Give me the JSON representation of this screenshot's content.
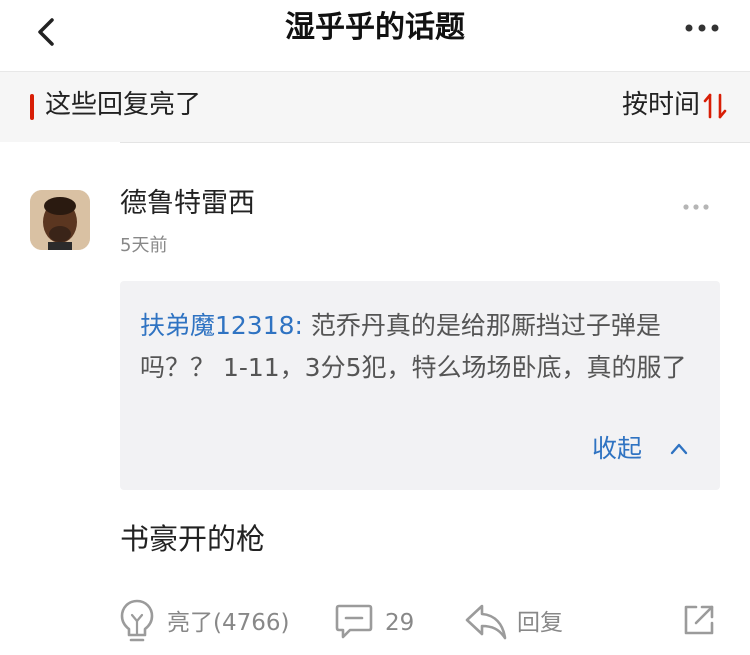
{
  "nav": {
    "title": "湿乎乎的话题",
    "back_icon": "chevron-left-icon",
    "more_icon": "more-horizontal-icon"
  },
  "section": {
    "title": "这些回复亮了",
    "sort_label": "按时间",
    "sort_icon": "sort-arrows-icon",
    "accent_color": "#d81e06"
  },
  "comment": {
    "username": "德鲁特雷西",
    "time": "5天前",
    "quote": {
      "author": "扶弟魔12318:",
      "text": " 范乔丹真的是给那厮挡过子弹是吗？？ 1-11，3分5犯，特么场场卧底，真的服了",
      "collapse_label": "收起"
    },
    "reply_text": "书豪开的枪",
    "actions": {
      "like_label": "亮了(4766)",
      "comment_count": "29",
      "reply_label": "回复"
    }
  },
  "link_color": "#2f73c2"
}
